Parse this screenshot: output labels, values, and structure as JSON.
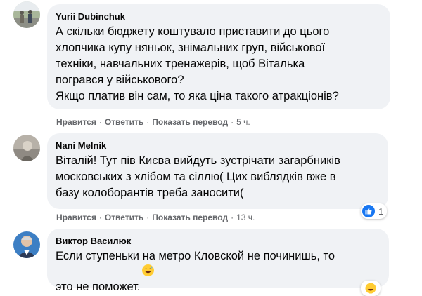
{
  "comments": [
    {
      "author": "Yurii Dubinchuk",
      "text": "А скільки бюджету коштувало приставити до цього\nхлопчика купу няньок, знімальних груп, військової\nтехніки, навчальних тренажерів, щоб Віталька\nпогрався у військового?\nЯкщо платив він сам, то яка ціна такого атракціонів?",
      "like": "Нравится",
      "reply": "Ответить",
      "translate": "Показать перевод",
      "time": "5 ч.",
      "avatar_icon": "user-photo"
    },
    {
      "author": "Nani Melnik",
      "text": "Віталій! Тут пів Києва вийдуть зустрічати загарбників\nмосковських з хлібом та сіллю( Цих виблядків вже в\nбазу колоборантів треба заносити(",
      "like": "Нравится",
      "reply": "Ответить",
      "translate": "Показать перевод",
      "time": "13 ч.",
      "reaction_count": "1",
      "reaction_icon": "like-icon",
      "avatar_icon": "user-photo"
    },
    {
      "author": "Виктор Василюк",
      "text": "Если ступеньки на метро Кловской не починишь, то\nэто не поможет.",
      "emoji": "grinning-sweat-emoji",
      "avatar_icon": "user-photo"
    }
  ],
  "colors": {
    "bubble": "#f0f2f5",
    "meta": "#65676b",
    "like_blue": "#1877f2"
  }
}
